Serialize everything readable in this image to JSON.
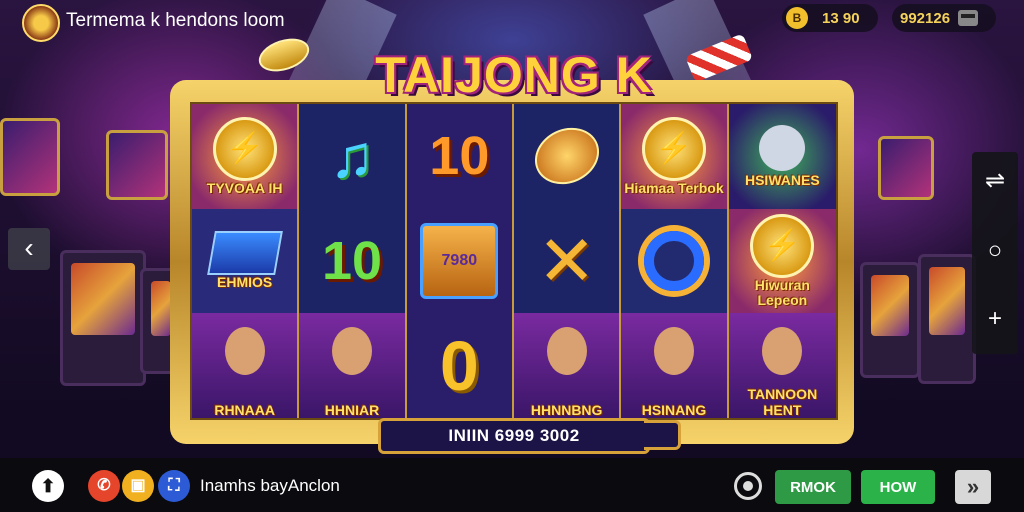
{
  "app": {
    "title": "Termema k hendons loom",
    "logo_icon": "casino-coin-icon"
  },
  "balances": [
    {
      "icon": "coin-icon",
      "icon_text": "B",
      "value": "13 90"
    },
    {
      "icon": "wallet-icon",
      "value": "992126"
    }
  ],
  "game": {
    "title": "TAIJONG K",
    "reels": [
      [
        {
          "type": "coin",
          "label": "TYVOAA IH"
        },
        {
          "type": "diamond",
          "label": "EHMIOS"
        },
        {
          "type": "portrait",
          "label": "RHNAAA"
        }
      ],
      [
        {
          "type": "note",
          "label": ""
        },
        {
          "type": "number",
          "text": "10",
          "color": "#6fe24a"
        },
        {
          "type": "portrait",
          "label": "HHNIAR"
        }
      ],
      [
        {
          "type": "number",
          "text": "10",
          "color": "#ff9a2a"
        },
        {
          "type": "chest",
          "text": "7980"
        },
        {
          "type": "zero",
          "text": "0"
        }
      ],
      [
        {
          "type": "gem",
          "label": ""
        },
        {
          "type": "cross",
          "label": ""
        },
        {
          "type": "portrait",
          "label": "HHNNBNG"
        }
      ],
      [
        {
          "type": "coin",
          "label": "Hiamaa Terbok"
        },
        {
          "type": "ring",
          "label": ""
        },
        {
          "type": "portrait",
          "label": "HSINANG"
        }
      ],
      [
        {
          "type": "wolf",
          "label": "HSIWANES"
        },
        {
          "type": "coin",
          "label": "Hiwuran Lepeon"
        },
        {
          "type": "portrait",
          "label": "TANNOON HENT"
        }
      ]
    ],
    "win_text": "INIIN 6999 3002"
  },
  "side": {
    "back_icon": "‹",
    "buttons": [
      {
        "name": "swap-icon",
        "glyph": "⇌"
      },
      {
        "name": "circle-icon",
        "glyph": "○"
      },
      {
        "name": "plus-icon",
        "glyph": "+"
      }
    ]
  },
  "bottom": {
    "up_glyph": "⬆",
    "social": [
      {
        "name": "phone-icon",
        "glyph": "✆",
        "color": "#e5452b"
      },
      {
        "name": "image-icon",
        "glyph": "▣",
        "color": "#f0b020"
      },
      {
        "name": "people-icon",
        "glyph": "⛶",
        "color": "#2d5bd6"
      }
    ],
    "label": "Inamhs bayAnclon",
    "btn1": "RMOK",
    "btn2": "HOW",
    "next_glyph": "»"
  },
  "colors": {
    "gold": "#d8a23a",
    "green_btn": "#2f9a45",
    "green_btn2": "#2bb34a"
  }
}
